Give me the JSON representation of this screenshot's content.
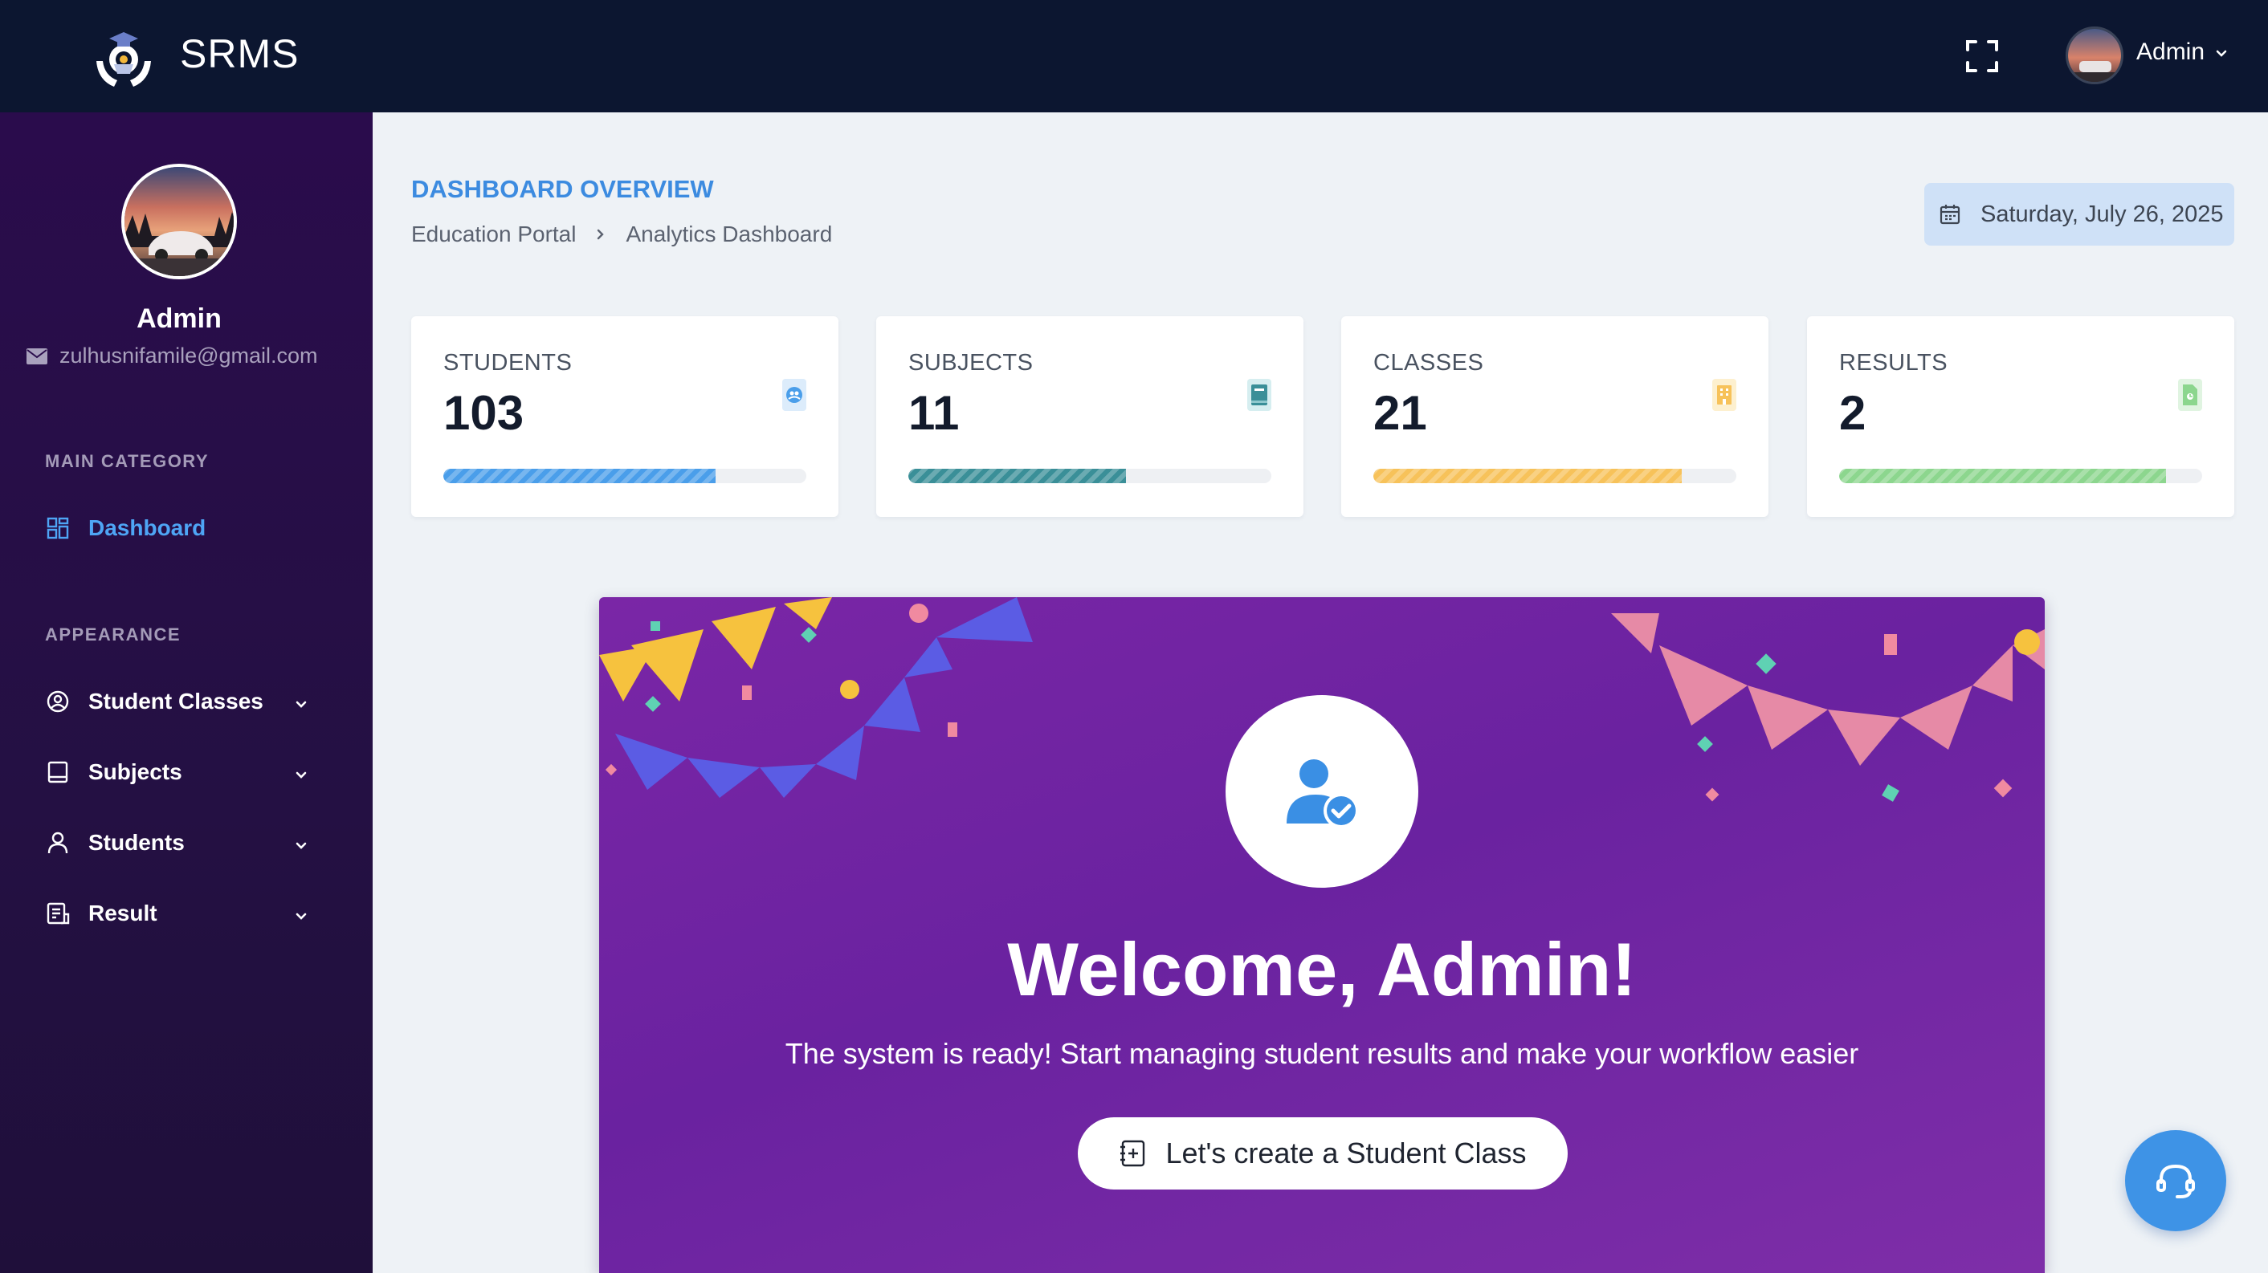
{
  "app": {
    "name": "SRMS"
  },
  "topbar": {
    "user_name": "Admin",
    "avatar": "user-avatar"
  },
  "sidebar": {
    "user_name": "Admin",
    "user_email": "zulhusnifamile@gmail.com",
    "sections": [
      {
        "title": "MAIN CATEGORY"
      },
      {
        "title": "APPEARANCE"
      }
    ],
    "items": [
      {
        "label": "Dashboard",
        "icon": "dashboard-icon",
        "active": true
      },
      {
        "label": "Student Classes",
        "icon": "user-circle-icon"
      },
      {
        "label": "Subjects",
        "icon": "book-icon"
      },
      {
        "label": "Students",
        "icon": "user-icon"
      },
      {
        "label": "Result",
        "icon": "report-icon"
      }
    ]
  },
  "header": {
    "title": "DASHBOARD OVERVIEW",
    "breadcrumb": [
      "Education Portal",
      "Analytics Dashboard"
    ],
    "date": "Saturday, July 26, 2025"
  },
  "stats": [
    {
      "label": "STUDENTS",
      "value": "103",
      "progress": 0.75,
      "color": "#4a9eea",
      "icon": "users-icon"
    },
    {
      "label": "SUBJECTS",
      "value": "11",
      "progress": 0.6,
      "color": "#3a8f98",
      "icon": "book-icon"
    },
    {
      "label": "CLASSES",
      "value": "21",
      "progress": 0.85,
      "color": "#f7c25a",
      "icon": "building-icon"
    },
    {
      "label": "RESULTS",
      "value": "2",
      "progress": 0.9,
      "color": "#8cd68e",
      "icon": "document-icon"
    }
  ],
  "welcome": {
    "title": "Welcome, Admin!",
    "subtitle": "The system is ready! Start managing student results and make your workflow easier",
    "button_label": "Let's create a Student Class"
  },
  "colors": {
    "topbar_bg": "#0c1630",
    "sidebar_bg": "#2a0c4c",
    "accent": "#3c8be0",
    "banner_bg": "#7a26a6"
  }
}
